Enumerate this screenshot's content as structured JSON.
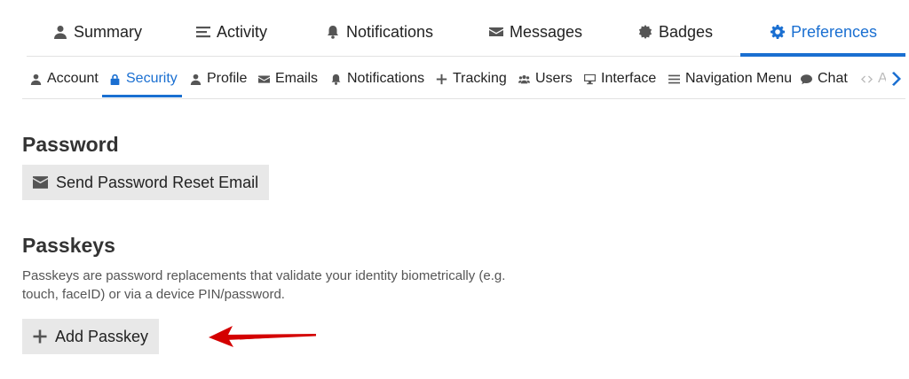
{
  "top_tabs": [
    {
      "label": "Summary",
      "icon": "user-icon"
    },
    {
      "label": "Activity",
      "icon": "list-icon"
    },
    {
      "label": "Notifications",
      "icon": "bell-icon"
    },
    {
      "label": "Messages",
      "icon": "envelope-icon"
    },
    {
      "label": "Badges",
      "icon": "badge-icon"
    },
    {
      "label": "Preferences",
      "icon": "gear-icon",
      "active": true
    }
  ],
  "sub_tabs": [
    {
      "label": "Account",
      "icon": "user-icon"
    },
    {
      "label": "Security",
      "icon": "lock-icon",
      "active": true
    },
    {
      "label": "Profile",
      "icon": "user-icon"
    },
    {
      "label": "Emails",
      "icon": "envelope-icon"
    },
    {
      "label": "Notifications",
      "icon": "bell-icon"
    },
    {
      "label": "Tracking",
      "icon": "plus-icon"
    },
    {
      "label": "Users",
      "icon": "users-icon"
    },
    {
      "label": "Interface",
      "icon": "desktop-icon"
    },
    {
      "label": "Navigation Menu",
      "icon": "list-icon"
    },
    {
      "label": "Chat",
      "icon": "comment-icon"
    },
    {
      "label": "A",
      "icon": "code-icon"
    }
  ],
  "password": {
    "title": "Password",
    "reset_button": "Send Password Reset Email"
  },
  "passkeys": {
    "title": "Passkeys",
    "description": "Passkeys are password replacements that validate your identity biometrically (e.g. touch, faceID) or via a device PIN/password.",
    "add_button": "Add Passkey"
  },
  "colors": {
    "accent": "#1a6fd1",
    "button_bg": "#e8e8e8",
    "arrow": "#d40000"
  }
}
